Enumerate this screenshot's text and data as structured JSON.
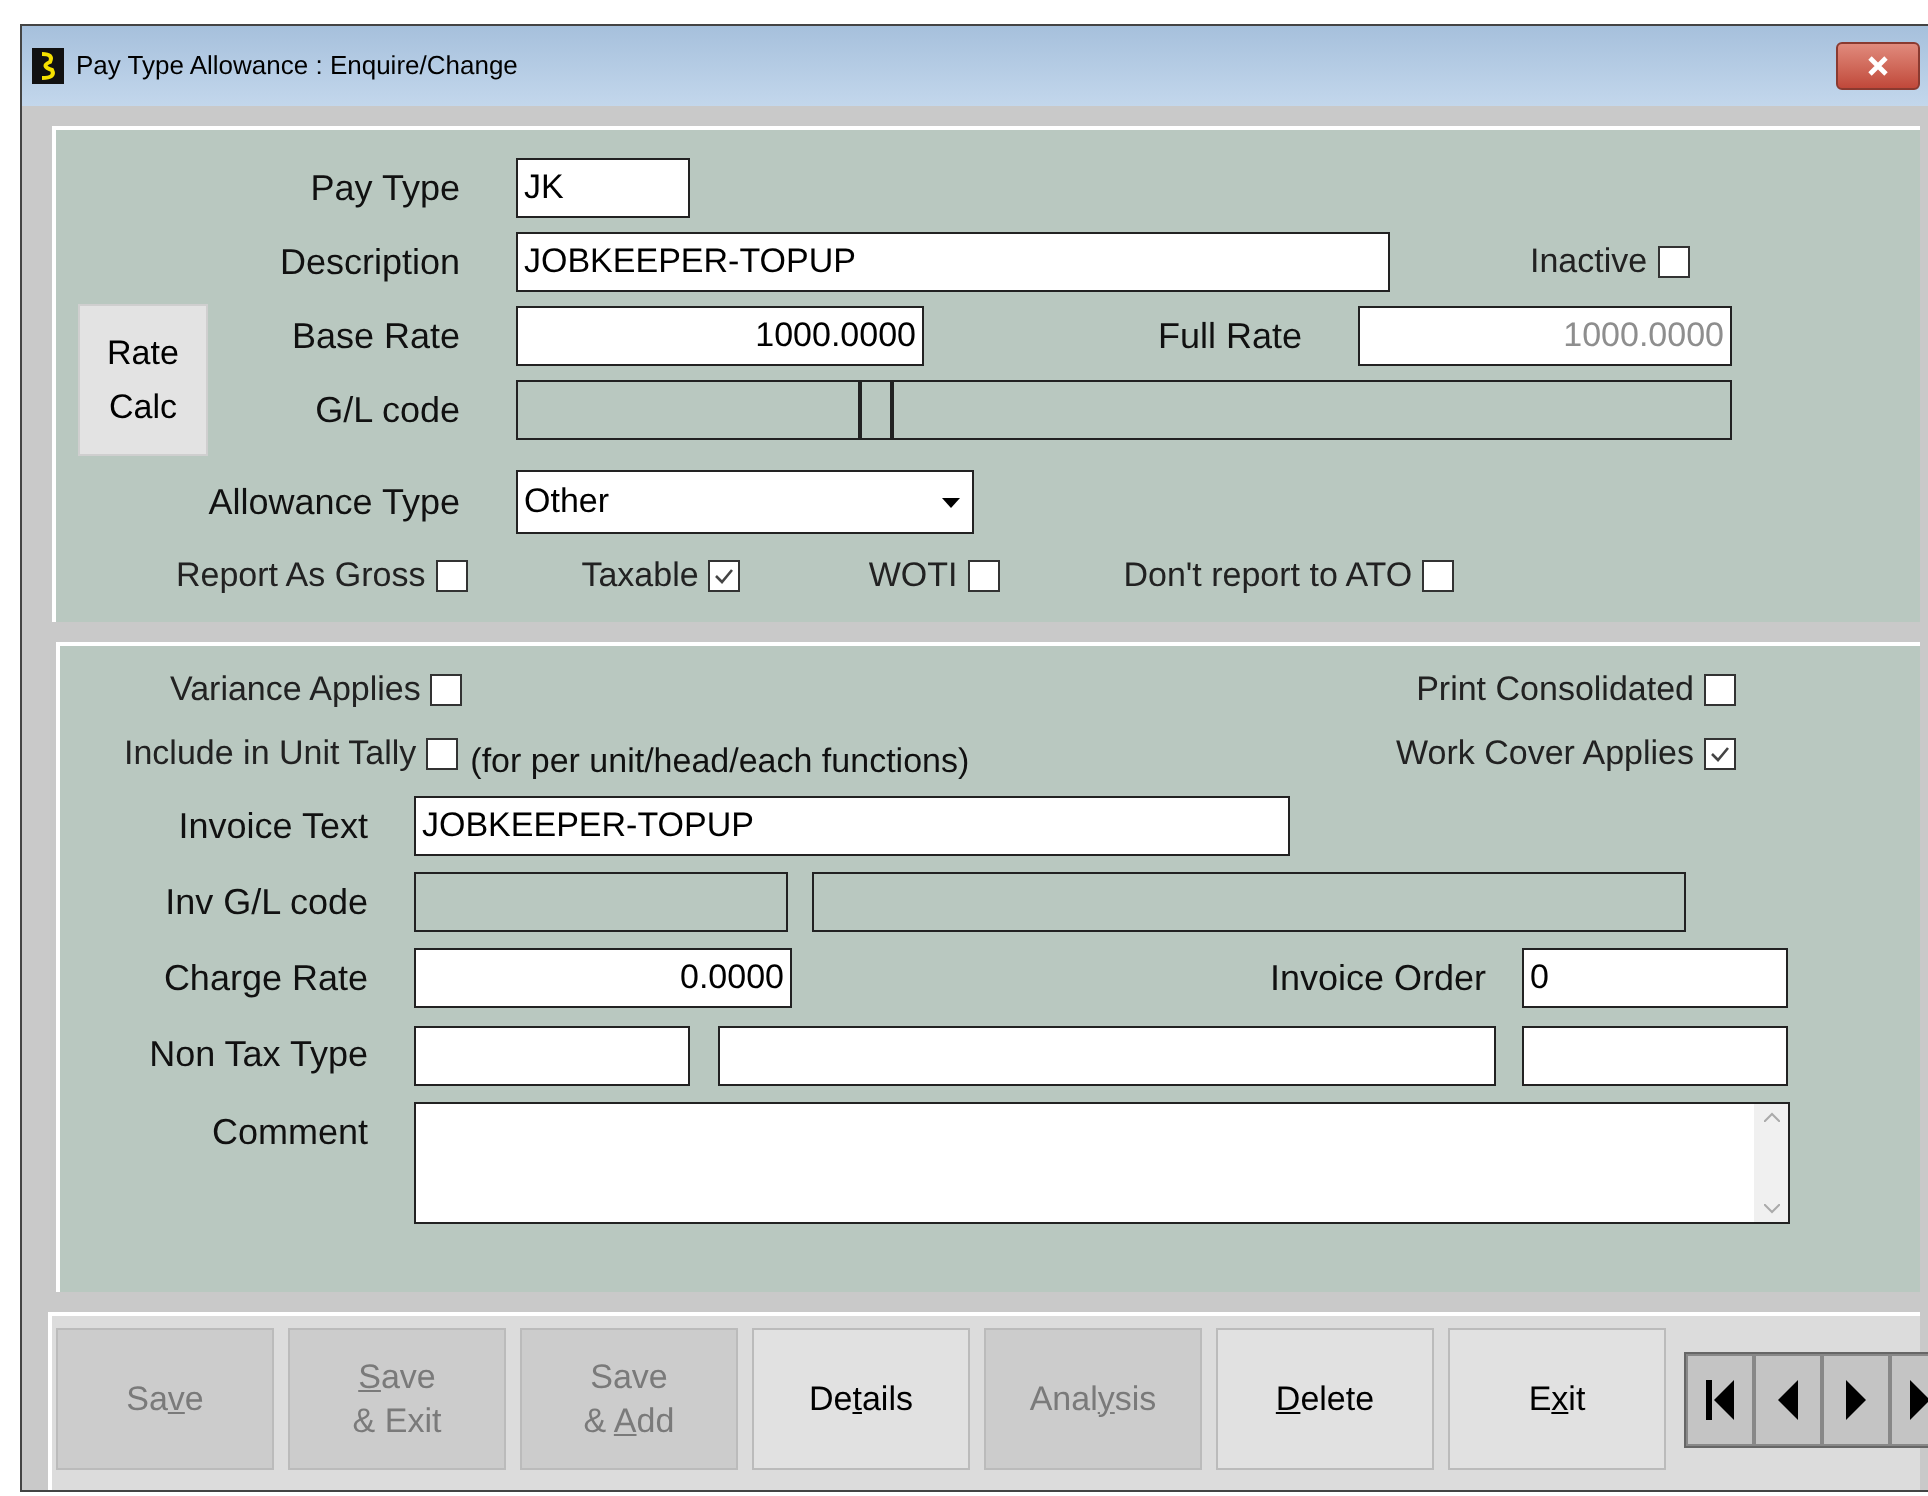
{
  "window": {
    "title": "Pay Type Allowance : Enquire/Change"
  },
  "header_panel": {
    "pay_type": {
      "label": "Pay Type",
      "value": "JK"
    },
    "description": {
      "label": "Description",
      "value": "JOBKEEPER-TOPUP"
    },
    "inactive": {
      "label": "Inactive",
      "checked": false
    },
    "rate_calc_button": [
      "Rate",
      "Calc"
    ],
    "base_rate": {
      "label": "Base Rate",
      "value": "1000.0000"
    },
    "full_rate": {
      "label": "Full Rate",
      "value": "1000.0000",
      "disabled": true
    },
    "gl_code": {
      "label": "G/L code"
    },
    "allowance_type": {
      "label": "Allowance Type",
      "value": "Other"
    },
    "flags": [
      {
        "label": "Report As Gross",
        "checked": false
      },
      {
        "label": "Taxable",
        "checked": true
      },
      {
        "label": "WOTI",
        "checked": false
      },
      {
        "label": "Don't report to ATO",
        "checked": false
      }
    ]
  },
  "detail_panel": {
    "variance_applies": {
      "label": "Variance Applies",
      "checked": false
    },
    "print_consolidated": {
      "label": "Print Consolidated",
      "checked": false
    },
    "include_in_unit_tally": {
      "label": "Include in Unit Tally",
      "checked": false,
      "note": "(for per unit/head/each functions)"
    },
    "work_cover_applies": {
      "label": "Work Cover Applies",
      "checked": true
    },
    "invoice_text": {
      "label": "Invoice Text",
      "value": "JOBKEEPER-TOPUP"
    },
    "inv_gl_code": {
      "label": "Inv G/L code"
    },
    "charge_rate": {
      "label": "Charge Rate",
      "value": "0.0000"
    },
    "invoice_order": {
      "label": "Invoice Order",
      "value": "0"
    },
    "non_tax_type": {
      "label": "Non Tax Type"
    },
    "comment": {
      "label": "Comment"
    }
  },
  "buttons": [
    {
      "lines": [
        [
          {
            "text": "Sa",
            "underlined": false
          },
          {
            "text": "v",
            "underlined": true
          },
          {
            "text": "e",
            "underlined": false
          }
        ]
      ],
      "disabled": true
    },
    {
      "lines": [
        [
          {
            "text": "S",
            "underlined": true
          },
          {
            "text": "ave",
            "underlined": false
          }
        ],
        [
          {
            "text": "& Exit",
            "underlined": false
          }
        ]
      ],
      "disabled": true
    },
    {
      "lines": [
        [
          {
            "text": "Save",
            "underlined": false
          }
        ],
        [
          {
            "text": "& ",
            "underlined": false
          },
          {
            "text": "A",
            "underlined": true
          },
          {
            "text": "dd",
            "underlined": false
          }
        ]
      ],
      "disabled": true
    },
    {
      "lines": [
        [
          {
            "text": "De",
            "underlined": false
          },
          {
            "text": "t",
            "underlined": true
          },
          {
            "text": "ails",
            "underlined": false
          }
        ]
      ],
      "disabled": false
    },
    {
      "lines": [
        [
          {
            "text": "Anal",
            "underlined": false
          },
          {
            "text": "y",
            "underlined": true
          },
          {
            "text": "sis",
            "underlined": false
          }
        ]
      ],
      "disabled": true
    },
    {
      "lines": [
        [
          {
            "text": "D",
            "underlined": true
          },
          {
            "text": "elete",
            "underlined": false
          }
        ]
      ],
      "disabled": false
    },
    {
      "lines": [
        [
          {
            "text": "E",
            "underlined": false
          },
          {
            "text": "x",
            "underlined": true
          },
          {
            "text": "it",
            "underlined": false
          }
        ]
      ],
      "disabled": false
    }
  ],
  "navigation": [
    {
      "kind": "first"
    },
    {
      "kind": "previous"
    },
    {
      "kind": "next"
    },
    {
      "kind": "last"
    }
  ]
}
